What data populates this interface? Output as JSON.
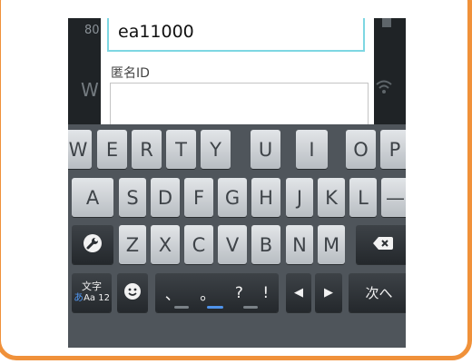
{
  "background": {
    "status_number": "80",
    "title_fragment": "W"
  },
  "dialog": {
    "input_value": "ea11000",
    "anon_id_label": "匿名ID",
    "anon_id_value": ""
  },
  "keyboard": {
    "row1": [
      "W",
      "E",
      "R",
      "T",
      "Y",
      "U",
      "I",
      "O",
      "P"
    ],
    "row2": [
      "A",
      "S",
      "D",
      "F",
      "G",
      "H",
      "J",
      "K",
      "L",
      "—"
    ],
    "row3": [
      "Z",
      "X",
      "C",
      "V",
      "B",
      "N",
      "M"
    ],
    "mode_top": "文字",
    "mode_hira": "あ",
    "mode_alpha": "Aa 12",
    "punct": [
      "、",
      "。",
      "?",
      "!"
    ],
    "left_arrow": "◀",
    "right_arrow": "▶",
    "next_label": "次へ",
    "tool_icon": "wrench-icon",
    "backspace_icon": "backspace-icon",
    "emoji_icon": "smiley-icon"
  },
  "colors": {
    "frame": "#f0913a",
    "input_focus": "#7ed7e2",
    "indicator_active": "#4f93ea"
  }
}
